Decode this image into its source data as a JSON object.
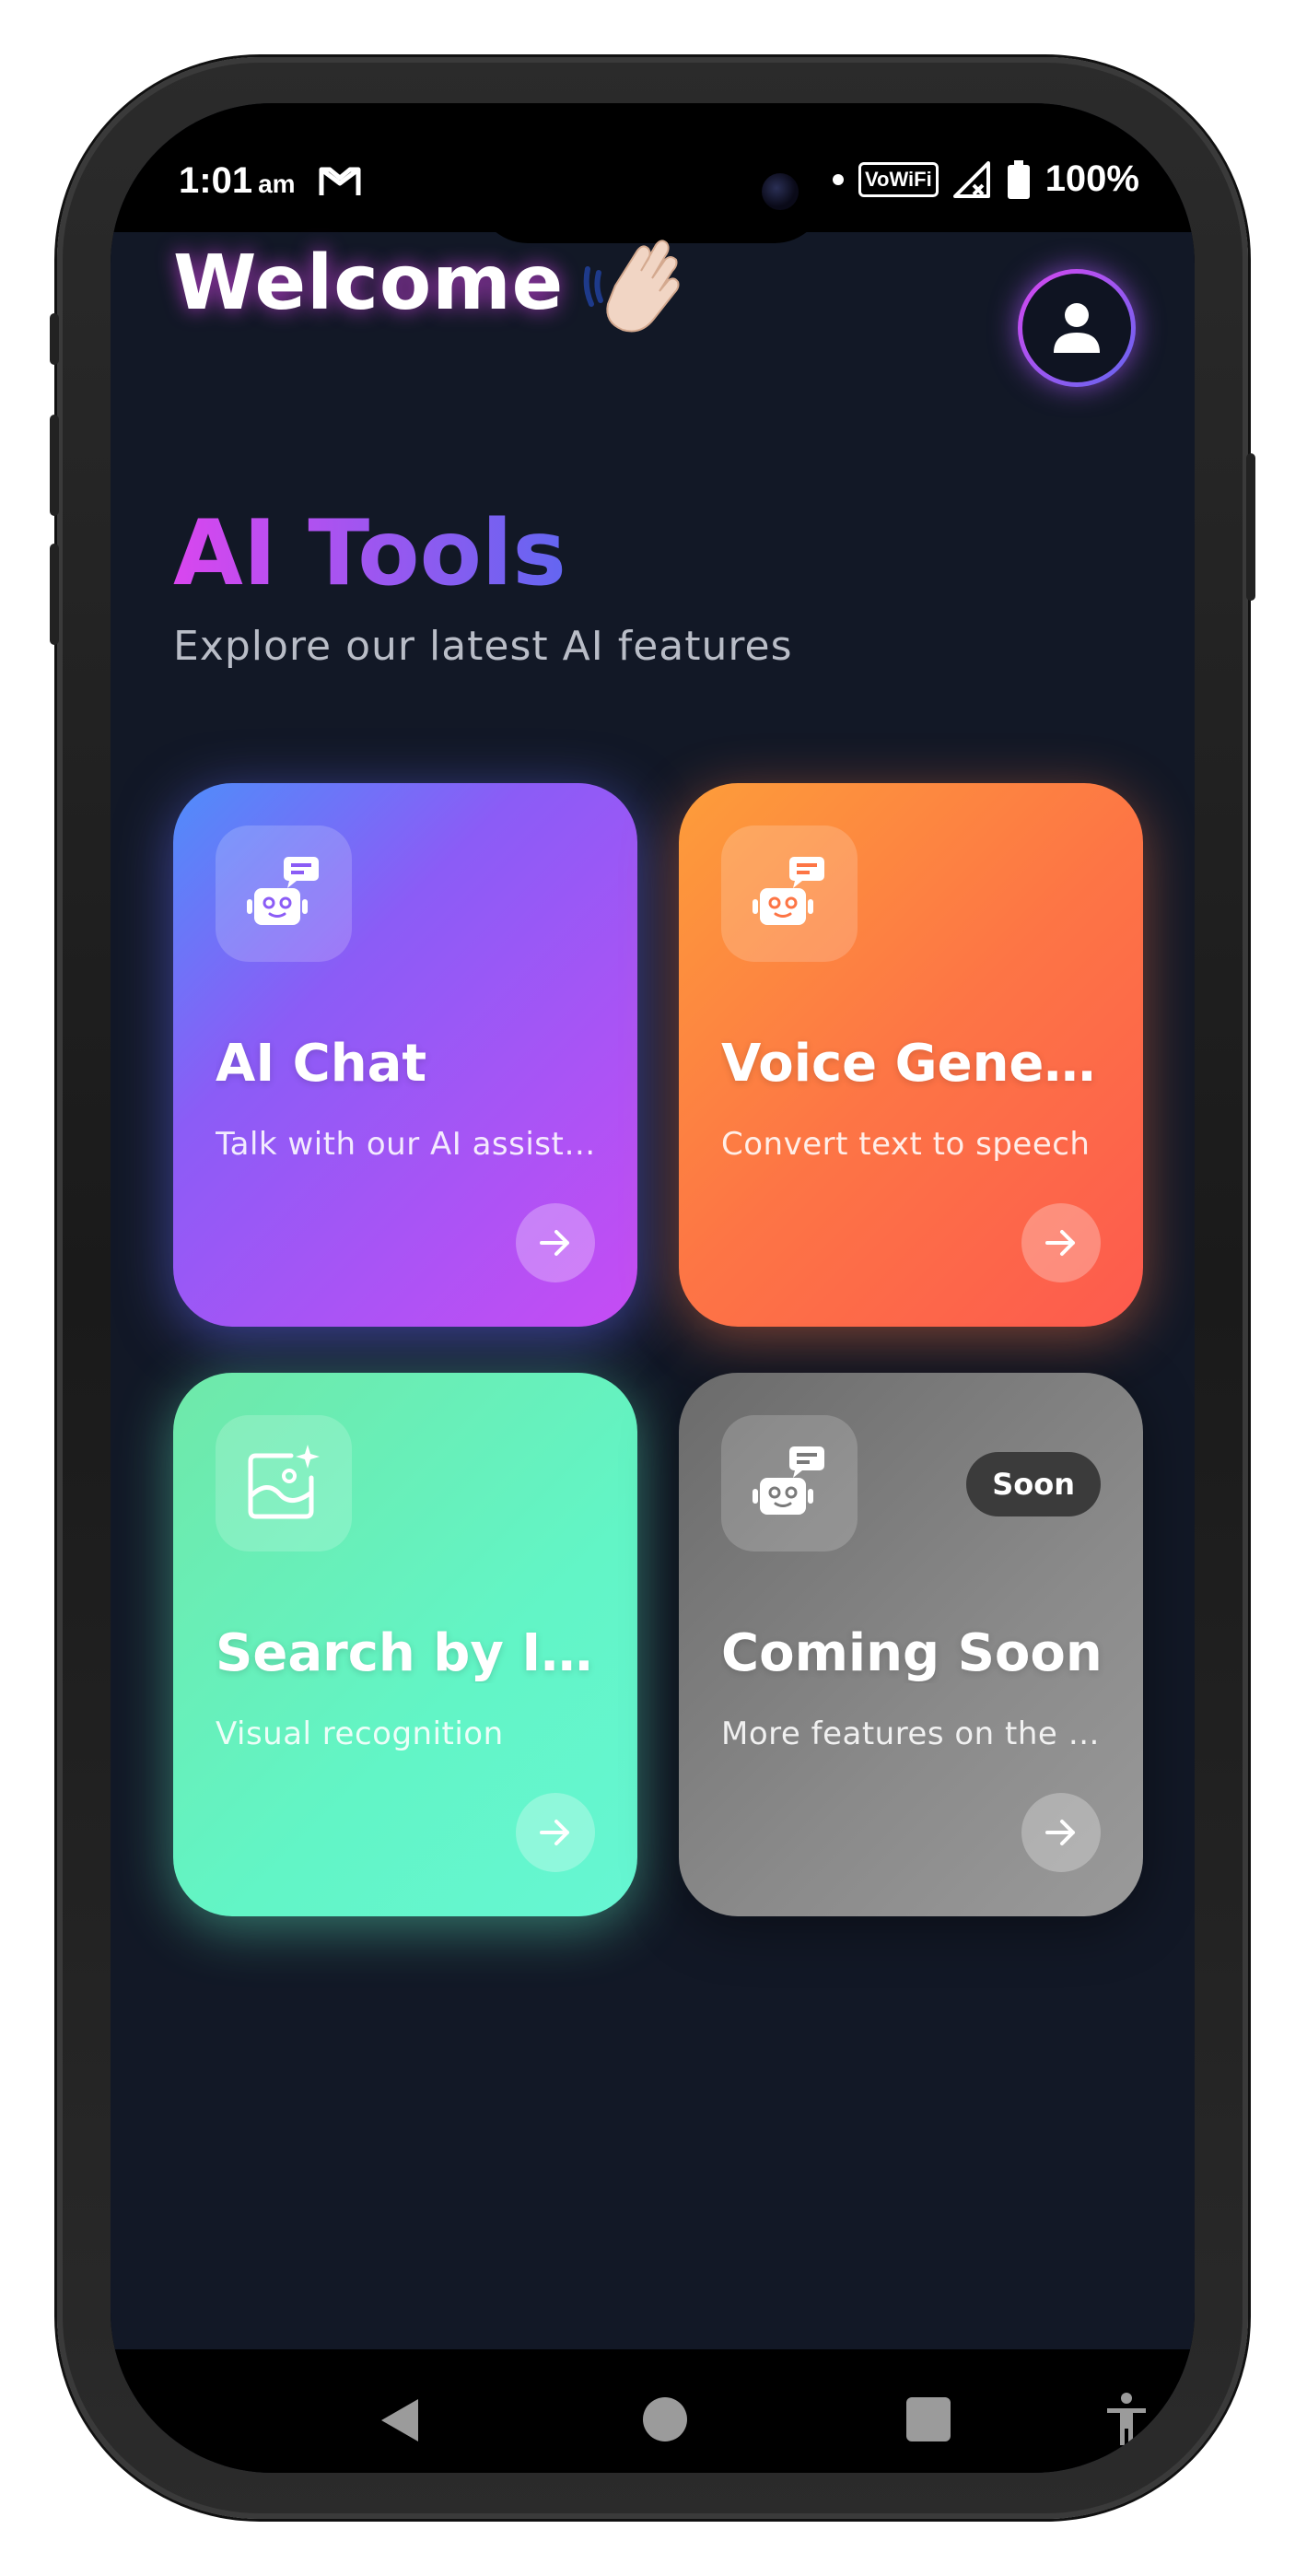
{
  "status_bar": {
    "time": "1:01",
    "ampm": "am",
    "network_label": "VoWiFi",
    "battery": "100%",
    "icons": [
      "gmail-icon",
      "dot-icon",
      "vowifi-icon",
      "signal-icon",
      "battery-icon"
    ]
  },
  "header": {
    "welcome": "Welcome",
    "emoji": "waving-hand-icon",
    "profile_icon": "user-icon"
  },
  "section": {
    "title": "AI Tools",
    "subtitle": "Explore our latest AI features"
  },
  "cards": [
    {
      "title": "AI Chat",
      "description": "Talk with our AI assistant",
      "icon": "chatbot-icon",
      "colors": [
        "#4f8dfa",
        "#8b5cf6",
        "#c64cf4"
      ]
    },
    {
      "title": "Voice Generator",
      "description": "Convert text to speech",
      "icon": "chatbot-icon",
      "colors": [
        "#fd9d3a",
        "#fd7545",
        "#fd5a4e"
      ]
    },
    {
      "title": "Search by Image",
      "description": "Visual recognition",
      "icon": "image-sparkle-icon",
      "colors": [
        "#6fe8a9",
        "#62f5c6",
        "#66f6d3"
      ]
    },
    {
      "title": "Coming Soon",
      "description": "More features on the way",
      "icon": "chatbot-icon",
      "badge": "Soon",
      "colors": [
        "#6b6b6b",
        "#8a8a8a",
        "#9a9a9a"
      ]
    }
  ],
  "nav_bar": {
    "buttons": [
      "back-icon",
      "home-icon",
      "recents-icon",
      "accessibility-icon"
    ]
  },
  "theme": {
    "background": "#121826",
    "accent_start": "#d946ef",
    "accent_end": "#6366f1",
    "subtitle_color": "#b9bdc7"
  }
}
